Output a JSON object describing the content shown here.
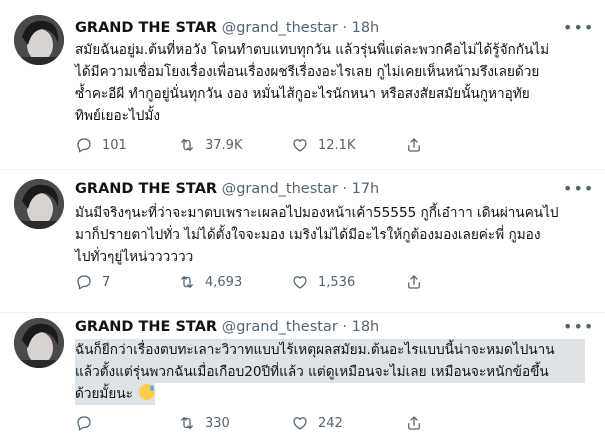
{
  "tweets": [
    {
      "name": "GRAND THE STAR",
      "handle": "@grand_thestar",
      "dot": "·",
      "time": "18h",
      "lines": [
        "สมัยฉันอยู่ม.ต้นที่หอวัง โดนทำตบแทบทุกวัน แล้วรุ่นพี่แต่ละพวกคือไม่ได้รู้จักกันไม่",
        "ได้มีความเชื่อมโยงเรื่องเพื่อนเรื่องผชรีเรื่องอะไรเลย กูไม่เคยเห็นหน้ามรึงเลยด้วย",
        "ซ้ำคะอีผี ทำกูอยู่นั่นทุกวัน งอง หมั่นไส้กูอะไรนักหนา หรือสงสัยสมัยนั้นกูหาอุทัย",
        "ทิพย์เยอะไปมั้ง"
      ],
      "replies": "101",
      "retweets": "37.9K",
      "likes": "12.1K"
    },
    {
      "name": "GRAND THE STAR",
      "handle": "@grand_thestar",
      "dot": "·",
      "time": "17h",
      "lines": [
        "มันมีจริงๆนะที่ว่าจะมาตบเพราะเผลอไปมองหน้าเค้า55555 กูกี้เอ๋าาา เดินผ่านคนไป",
        "มาก็ปรายตาไปทั่ว ไม่ได้ตั้งใจจะมอง เมริงไม่ได้มีอะไรให้กูต้องมองเลยค่ะพี่ กูมอง",
        "ไปทั่วๆยู่ไหน่วววววว"
      ],
      "replies": "7",
      "retweets": "4,693",
      "likes": "1,536"
    },
    {
      "name": "GRAND THE STAR",
      "handle": "@grand_thestar",
      "dot": "·",
      "time": "18h",
      "lines": [
        "ฉันก็ยีกว่าเรื่องตบทะเลาะวิวาทแบบไร้เหตุผลสมัยม.ต้นอะไรแบบนี้น่าจะหมดไปนาน",
        "แล้วตั้งแต่รุ่นพวกฉันเมื่อเกือบ20ปีที่แล้ว แต่ดูเหมือนจะไม่เลย เหมือนจะหนักข้อขึ้น",
        "ด้วยมั้ยนะ"
      ],
      "emoji": "downcast-sweat-emoji",
      "replies": "",
      "retweets": "330",
      "likes": "242"
    }
  ],
  "icons": {
    "more": "ellipsis-icon",
    "reply": "reply-icon",
    "retweet": "retweet-icon",
    "like": "heart-icon",
    "share": "share-icon"
  },
  "colors": {
    "text": "#0f1419",
    "secondary": "#536471",
    "highlight": "#dde3e7",
    "divider": "#eff3f4"
  }
}
